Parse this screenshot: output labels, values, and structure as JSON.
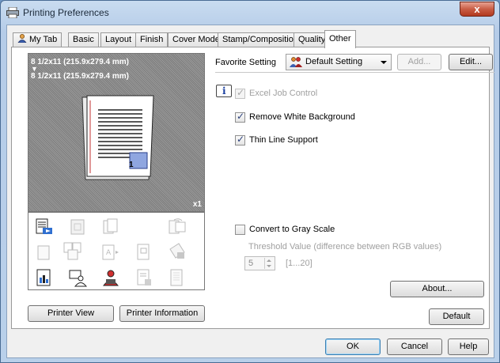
{
  "window": {
    "title": "Printing Preferences",
    "close_glyph": "x"
  },
  "tabs": [
    {
      "label": "My Tab"
    },
    {
      "label": "Basic"
    },
    {
      "label": "Layout"
    },
    {
      "label": "Finish"
    },
    {
      "label": "Cover Mode"
    },
    {
      "label": "Stamp/Composition"
    },
    {
      "label": "Quality"
    },
    {
      "label": "Other",
      "active": true
    }
  ],
  "preview": {
    "paper_size_from": "8 1/2x11 (215.9x279.4 mm)",
    "arrow": "▼",
    "paper_size_to": "8 1/2x11 (215.9x279.4 mm)",
    "copies": "x1",
    "page_number": "1"
  },
  "left_buttons": {
    "printer_view": "Printer View",
    "printer_information": "Printer Information"
  },
  "favorite": {
    "label": "Favorite Setting",
    "value": "Default Setting",
    "add": "Add...",
    "edit": "Edit..."
  },
  "options": {
    "excel_job_control": {
      "label": "Excel Job Control",
      "checked": true,
      "enabled": false
    },
    "remove_white_background": {
      "label": "Remove White Background",
      "checked": true
    },
    "thin_line_support": {
      "label": "Thin Line Support",
      "checked": true
    },
    "convert_to_gray_scale": {
      "label": "Convert to Gray Scale",
      "checked": false
    }
  },
  "threshold": {
    "label": "Threshold Value (difference between RGB values)",
    "value": "5",
    "range": "[1...20]"
  },
  "buttons": {
    "about": "About...",
    "default": "Default",
    "ok": "OK",
    "cancel": "Cancel",
    "help": "Help"
  },
  "colors": {
    "title_bar": "#b9d0ea",
    "close_button": "#c95d45",
    "preview_background": "#8a8a8a",
    "accent_blue": "#1a3fa0"
  }
}
